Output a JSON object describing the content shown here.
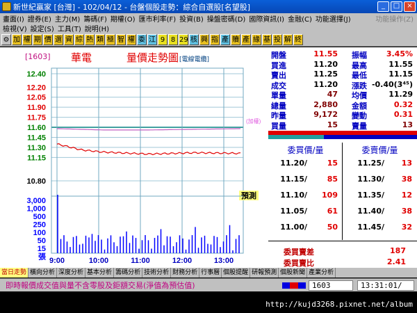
{
  "window": {
    "title": "新世紀贏家 [台灣] - 102/04/12 - 台盤個股走勢：綜合自選股[名望股]",
    "buttons": [
      "_",
      "□",
      "×"
    ]
  },
  "menu1": [
    "畫面(I)",
    "證券(E)",
    "主力(M)",
    "籌碼(F)",
    "期權(O)",
    "匯市利率(F)",
    "投資(B)",
    "操盤密碼(D)",
    "國際資訊(I)",
    "金融(C)",
    "功能選擇(J)",
    "功能操作(Z)"
  ],
  "menu2": [
    "檢視(V)",
    "設定(S)",
    "工具(T)",
    "說明(H)"
  ],
  "toolbar": [
    "⚙",
    "加",
    "權",
    "期",
    "價",
    "選",
    "資",
    "綜",
    "熱",
    "類",
    "極",
    "智",
    "權",
    "委",
    "江",
    "9",
    "8",
    "29",
    "核",
    "興",
    "指",
    "產",
    "贖",
    "產",
    "緣",
    "基",
    "投",
    "解",
    "終"
  ],
  "chart": {
    "code": "[1603]",
    "stock_name": "華電",
    "title": "量價走勢圖",
    "subtitle": "[電線電纜]",
    "ref_note": "(加權)",
    "predict_label": "預測",
    "price_ticks": [
      "12.40",
      "12.20",
      "12.05",
      "11.90",
      "11.75",
      "11.60",
      "11.45",
      "11.30",
      "11.15",
      "10.80"
    ],
    "vol_ticks": [
      "3,000",
      "1,000",
      "500",
      "250",
      "100",
      "50",
      "15",
      "張"
    ],
    "time_ticks": [
      "9:00",
      "10:00",
      "11:00",
      "12:00",
      "13:00"
    ]
  },
  "chart_data": {
    "type": "line",
    "title": "量價走勢圖",
    "xlabel": "",
    "ylabel": "",
    "x": [
      "9:00",
      "10:00",
      "11:00",
      "12:00",
      "13:00"
    ],
    "ylim": [
      10.8,
      12.4
    ],
    "series": [
      {
        "name": "價",
        "values": [
          11.3,
          11.23,
          11.2,
          11.22,
          11.21
        ]
      },
      {
        "name": "加權",
        "values": [
          11.58,
          11.56,
          11.56,
          11.57,
          11.58
        ]
      }
    ]
  },
  "quote": {
    "rows": [
      {
        "l1": "開盤",
        "v1": "11.55",
        "c1": "red",
        "l2": "振幅",
        "v2": "3.45%",
        "c2": "red"
      },
      {
        "l1": "買進",
        "v1": "11.20",
        "c1": "",
        "l2": "最高",
        "v2": "11.55",
        "c2": ""
      },
      {
        "l1": "賣出",
        "v1": "11.25",
        "c1": "",
        "l2": "最低",
        "v2": "11.15",
        "c2": ""
      },
      {
        "l1": "成交",
        "v1": "11.20",
        "c1": "",
        "l2": "漲跌",
        "v2": "-0.40(3⁴⁵)",
        "c2": ""
      },
      {
        "l1": "單量",
        "v1": "47",
        "c1": "maroon",
        "l2": "均價",
        "v2": "11.29",
        "c2": ""
      },
      {
        "l1": "總量",
        "v1": "2,880",
        "c1": "maroon",
        "l2": "金額",
        "v2": "0.32",
        "c2": "red"
      },
      {
        "l1": "昨量",
        "v1": "9,172",
        "c1": "maroon",
        "l2": "變動",
        "v2": "0.31",
        "c2": "red"
      },
      {
        "l1": "買量",
        "v1": "15",
        "c1": "maroon",
        "l2": "賣量",
        "v2": "13",
        "c2": "maroon"
      }
    ],
    "bid_header": "委買價/量",
    "ask_header": "委賣價/量",
    "bids": [
      {
        "price": "11.20",
        "qty": "15"
      },
      {
        "price": "11.15",
        "qty": "85"
      },
      {
        "price": "11.10",
        "qty": "109"
      },
      {
        "price": "11.05",
        "qty": "61"
      },
      {
        "price": "11.00",
        "qty": "50"
      }
    ],
    "asks": [
      {
        "price": "11.25",
        "qty": "13"
      },
      {
        "price": "11.30",
        "qty": "38"
      },
      {
        "price": "11.35",
        "qty": "12"
      },
      {
        "price": "11.40",
        "qty": "38"
      },
      {
        "price": "11.45",
        "qty": "32"
      }
    ],
    "diff_label": "委買賣差",
    "diff_value": "187",
    "ratio_label": "委買賣比",
    "ratio_value": "2.41"
  },
  "tabs": [
    "當日走勢",
    "橫向分析",
    "深度分析",
    "基本分析",
    "籌碼分析",
    "技術分析",
    "財務分析",
    "行事曆",
    "個股提醒",
    "研報預測",
    "個股新聞",
    "產業分析"
  ],
  "status": {
    "message": "即時報價成交值與量不含零股及鉅額交易(淨值為預估值)",
    "code": "1603",
    "time": "13:31:01/"
  },
  "footer_url": "http://kujd3268.pixnet.net/album"
}
